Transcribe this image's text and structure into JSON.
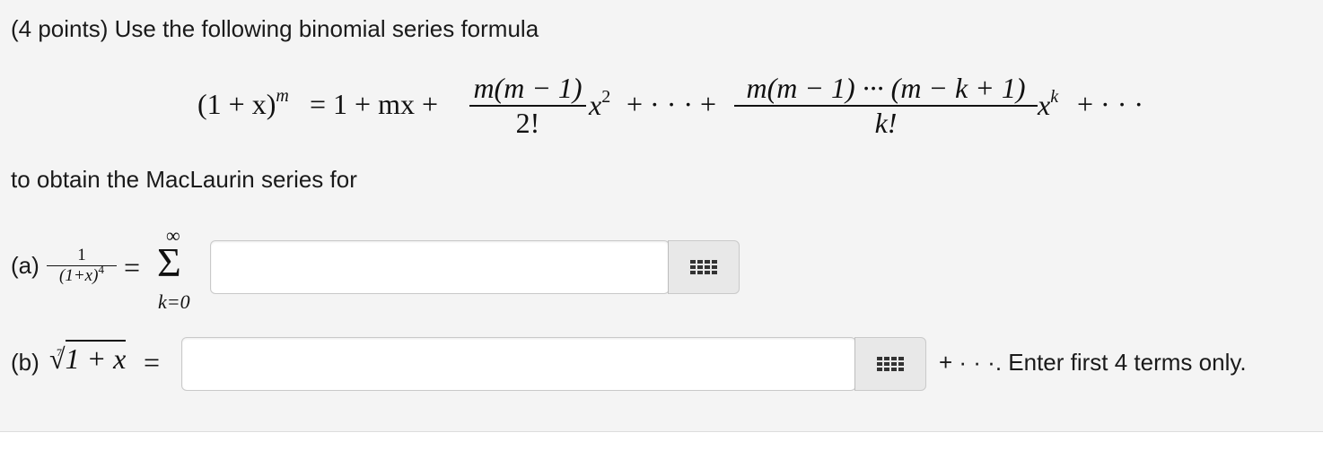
{
  "question": {
    "points_label": "(4 points) Use the following binomial series formula",
    "instruction": "to obtain the MacLaurin series for"
  },
  "formula": {
    "lhs": "(1 + x)",
    "lhs_exp": "m",
    "eq": "= 1 + mx +",
    "frac1_num": "m(m − 1)",
    "frac1_den": "2!",
    "term2": "x",
    "term2_exp": "2",
    "middle": "+ · · · +",
    "frac2_num": "m(m − 1) ··· (m − k + 1)",
    "frac2_den": "k!",
    "termk": "x",
    "termk_exp": "k",
    "tail": "+ · · ·"
  },
  "part_a": {
    "label": "(a)",
    "frac_num": "1",
    "frac_den": "(1+x)",
    "frac_den_exp": "4",
    "equals": "=",
    "sigma": "Σ",
    "sum_upper": "∞",
    "sum_lower": "k=0",
    "input_value": ""
  },
  "part_b": {
    "label": "(b)",
    "root_index": "7",
    "radical": "√",
    "radicand": "1 + x",
    "equals": "=",
    "input_value": "",
    "suffix": "+ · · ·. Enter first 4 terms only."
  },
  "icons": {
    "palette": "equation-palette-icon"
  }
}
